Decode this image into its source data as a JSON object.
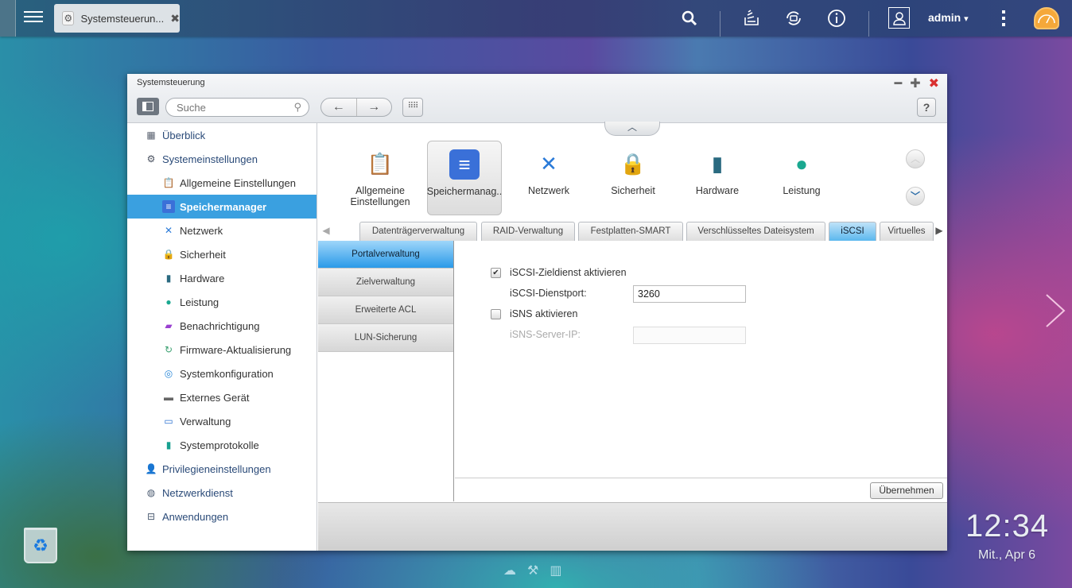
{
  "topbar": {
    "tab_label": "Systemsteuerun...",
    "tab_icon": "gear-icon",
    "icons": [
      "search-icon",
      "task-stack-icon",
      "sync-icon",
      "info-icon",
      "user-icon",
      "more-icon",
      "dashboard-icon"
    ],
    "user_label": "admin",
    "user_caret": "▾"
  },
  "window": {
    "title": "Systemsteuerung",
    "search_placeholder": "Suche",
    "help_label": "?"
  },
  "sidebar": {
    "items": [
      {
        "label": "Überblick",
        "level": 1,
        "icon": "overview-icon"
      },
      {
        "label": "Systemeinstellungen",
        "level": 1,
        "icon": "gear-icon"
      },
      {
        "label": "Allgemeine Einstellungen",
        "level": 2,
        "icon": "general-settings-icon"
      },
      {
        "label": "Speichermanager",
        "level": 2,
        "icon": "storage-icon",
        "active": true
      },
      {
        "label": "Netzwerk",
        "level": 2,
        "icon": "network-icon"
      },
      {
        "label": "Sicherheit",
        "level": 2,
        "icon": "lock-icon"
      },
      {
        "label": "Hardware",
        "level": 2,
        "icon": "hardware-icon"
      },
      {
        "label": "Leistung",
        "level": 2,
        "icon": "power-icon"
      },
      {
        "label": "Benachrichtigung",
        "level": 2,
        "icon": "notification-icon"
      },
      {
        "label": "Firmware-Aktualisierung",
        "level": 2,
        "icon": "firmware-icon"
      },
      {
        "label": "Systemkonfiguration",
        "level": 2,
        "icon": "config-icon"
      },
      {
        "label": "Externes Gerät",
        "level": 2,
        "icon": "external-device-icon"
      },
      {
        "label": "Verwaltung",
        "level": 2,
        "icon": "monitor-icon"
      },
      {
        "label": "Systemprotokolle",
        "level": 2,
        "icon": "log-icon"
      },
      {
        "label": "Privilegieneinstellungen",
        "level": 1,
        "icon": "user-icon"
      },
      {
        "label": "Netzwerkdienst",
        "level": 1,
        "icon": "globe-icon"
      },
      {
        "label": "Anwendungen",
        "level": 1,
        "icon": "inbox-icon"
      }
    ]
  },
  "icon_row": [
    {
      "label": "Allgemeine Einstellungen",
      "icon": "general-settings-icon"
    },
    {
      "label": "Speichermanag..",
      "icon": "storage-icon",
      "selected": true
    },
    {
      "label": "Netzwerk",
      "icon": "network-icon"
    },
    {
      "label": "Sicherheit",
      "icon": "lock-icon"
    },
    {
      "label": "Hardware",
      "icon": "hardware-icon"
    },
    {
      "label": "Leistung",
      "icon": "power-icon"
    }
  ],
  "subtabs": [
    {
      "label": "Datenträgerverwaltung"
    },
    {
      "label": "RAID-Verwaltung"
    },
    {
      "label": "Festplatten-SMART"
    },
    {
      "label": "Verschlüsseltes Dateisystem"
    },
    {
      "label": "iSCSI",
      "active": true
    },
    {
      "label": "Virtuelles"
    }
  ],
  "left_nav": [
    {
      "label": "Portalverwaltung",
      "active": true
    },
    {
      "label": "Zielverwaltung"
    },
    {
      "label": "Erweiterte ACL"
    },
    {
      "label": "LUN-Sicherung"
    }
  ],
  "form": {
    "iscsi_enable_label": "iSCSI-Zieldienst aktivieren",
    "iscsi_enable_checked": true,
    "port_label": "iSCSI-Dienstport:",
    "port_value": "3260",
    "isns_enable_label": "iSNS aktivieren",
    "isns_enable_checked": false,
    "isns_ip_label": "iSNS-Server-IP:",
    "isns_ip_value": "",
    "apply_label": "Übernehmen"
  },
  "desktop": {
    "time": "12:34",
    "date": "Mit., Apr 6"
  }
}
